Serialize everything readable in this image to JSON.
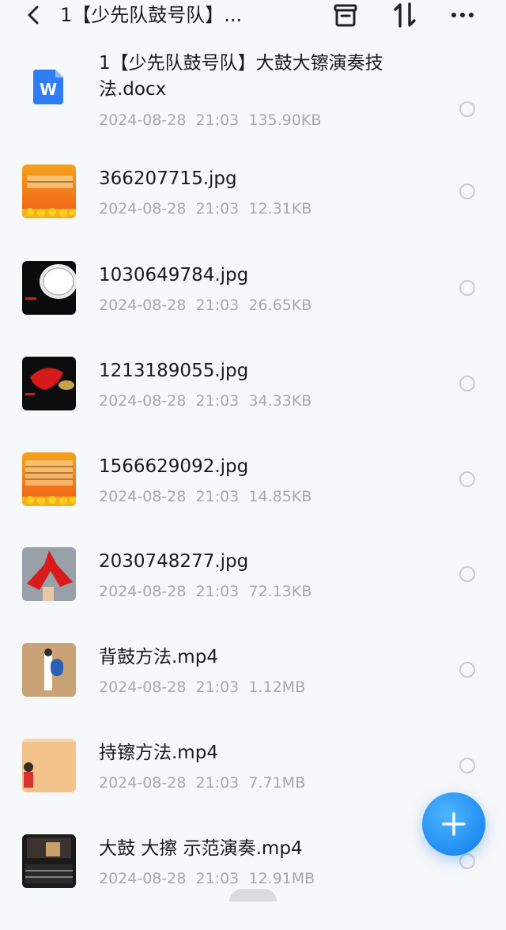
{
  "header": {
    "title": "1【少先队鼓号队】...",
    "back_icon": "chevron-left-icon",
    "archive_icon": "archive-box-icon",
    "sort_icon": "sort-arrows-icon",
    "more_icon": "more-dots-icon"
  },
  "files": [
    {
      "name": "1【少先队鼓号队】大鼓大镲演奏技法.docx",
      "date": "2024-08-28",
      "time": "21:03",
      "size": "135.90KB",
      "thumb": "word-doc-icon"
    },
    {
      "name": "366207715.jpg",
      "date": "2024-08-28",
      "time": "21:03",
      "size": "12.31KB",
      "thumb": "sheet-music-image"
    },
    {
      "name": "1030649784.jpg",
      "date": "2024-08-28",
      "time": "21:03",
      "size": "26.65KB",
      "thumb": "drum-image"
    },
    {
      "name": "1213189055.jpg",
      "date": "2024-08-28",
      "time": "21:03",
      "size": "34.33KB",
      "thumb": "red-scarf-cymbal-image"
    },
    {
      "name": "1566629092.jpg",
      "date": "2024-08-28",
      "time": "21:03",
      "size": "14.85KB",
      "thumb": "sheet-music-image"
    },
    {
      "name": "2030748277.jpg",
      "date": "2024-08-28",
      "time": "21:03",
      "size": "72.13KB",
      "thumb": "red-scarf-image"
    },
    {
      "name": "背鼓方法.mp4",
      "date": "2024-08-28",
      "time": "21:03",
      "size": "1.12MB",
      "thumb": "video-thumbnail"
    },
    {
      "name": "持镲方法.mp4",
      "date": "2024-08-28",
      "time": "21:03",
      "size": "7.71MB",
      "thumb": "video-thumbnail"
    },
    {
      "name": "大鼓 大擦 示范演奏.mp4",
      "date": "2024-08-28",
      "time": "21:03",
      "size": "12.91MB",
      "thumb": "video-thumbnail"
    }
  ],
  "fab": {
    "icon": "plus-icon"
  },
  "colors": {
    "accent": "#1f8cf2",
    "meta_text": "#a7a9ad",
    "word_blue": "#2e7cf6"
  }
}
